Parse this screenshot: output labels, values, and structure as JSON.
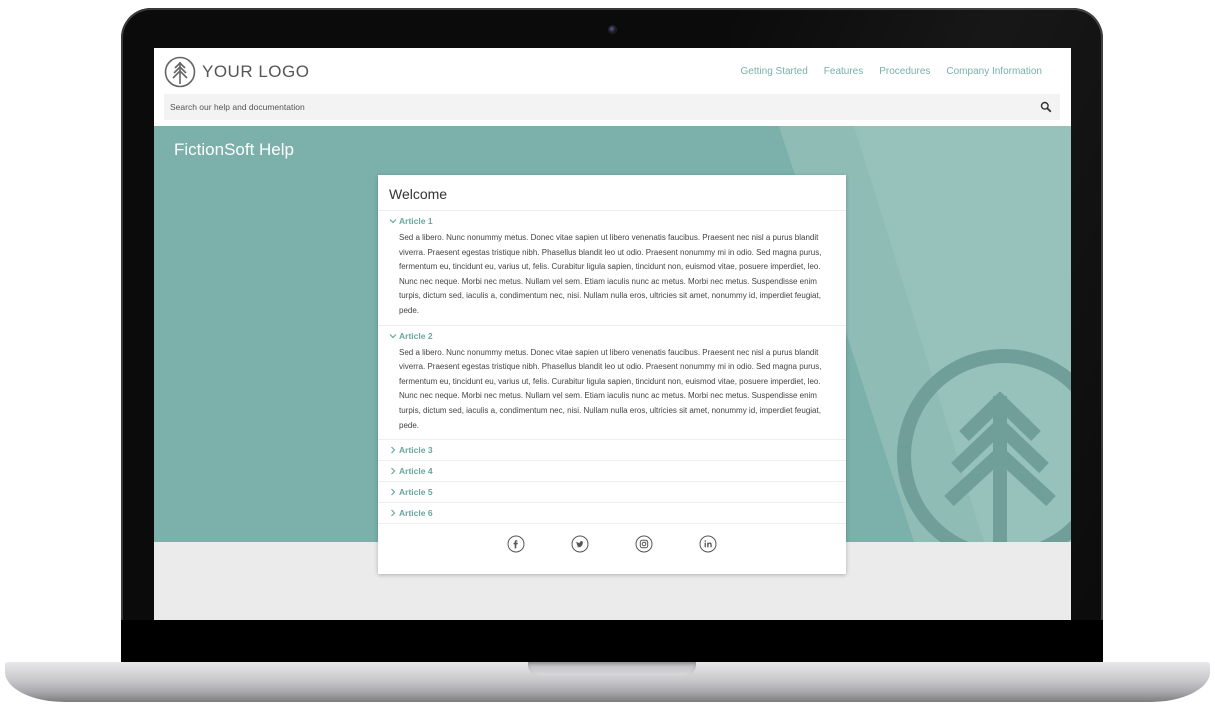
{
  "header": {
    "logo_text": "YOUR LOGO",
    "nav": [
      "Getting Started",
      "Features",
      "Procedures",
      "Company Information"
    ],
    "search_placeholder": "Search our help and documentation"
  },
  "hero": {
    "title": "FictionSoft Help"
  },
  "card": {
    "title": "Welcome",
    "articles": [
      {
        "label": "Article 1",
        "expanded": true,
        "body": "Sed a libero. Nunc nonummy metus. Donec vitae sapien ut libero venenatis faucibus. Praesent nec nisl a purus blandit viverra. Praesent egestas tristique nibh. Phasellus blandit leo ut odio. Praesent nonummy mi in odio. Sed magna purus, fermentum eu, tincidunt eu, varius ut, felis. Curabitur ligula sapien, tincidunt non, euismod vitae, posuere imperdiet, leo. Nunc nec neque. Morbi nec metus. Nullam vel sem. Etiam iaculis nunc ac metus. Morbi nec metus. Suspendisse enim turpis, dictum sed, iaculis a, condimentum nec, nisi. Nullam nulla eros, ultricies sit amet, nonummy id, imperdiet feugiat, pede."
      },
      {
        "label": "Article 2",
        "expanded": true,
        "body": "Sed a libero. Nunc nonummy metus. Donec vitae sapien ut libero venenatis faucibus. Praesent nec nisl a purus blandit viverra. Praesent egestas tristique nibh. Phasellus blandit leo ut odio. Praesent nonummy mi in odio. Sed magna purus, fermentum eu, tincidunt eu, varius ut, felis. Curabitur ligula sapien, tincidunt non, euismod vitae, posuere imperdiet, leo. Nunc nec neque. Morbi nec metus. Nullam vel sem. Etiam iaculis nunc ac metus. Morbi nec metus. Suspendisse enim turpis, dictum sed, iaculis a, condimentum nec, nisi. Nullam nulla eros, ultricies sit amet, nonummy id, imperdiet feugiat, pede."
      },
      {
        "label": "Article 3",
        "expanded": false
      },
      {
        "label": "Article 4",
        "expanded": false
      },
      {
        "label": "Article 5",
        "expanded": false
      },
      {
        "label": "Article 6",
        "expanded": false
      }
    ]
  },
  "social": [
    "facebook-icon",
    "twitter-icon",
    "instagram-icon",
    "linkedin-icon"
  ],
  "colors": {
    "accent": "#7ab0a7",
    "hero": "#7bb1aa",
    "article_link": "#6aa69d"
  }
}
